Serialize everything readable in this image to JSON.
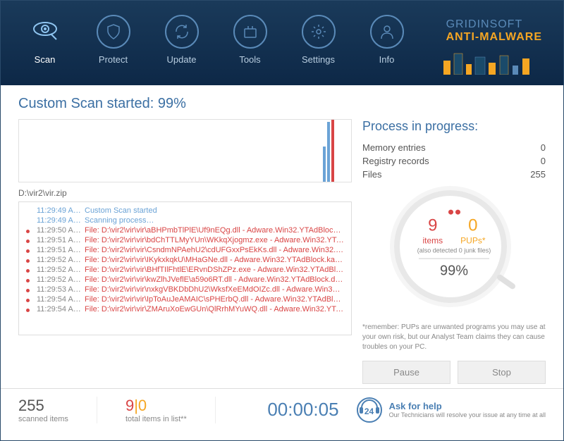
{
  "brand": {
    "line1": "GRIDINSOFT",
    "line2": "ANTI-MALWARE"
  },
  "nav": {
    "scan": "Scan",
    "protect": "Protect",
    "update": "Update",
    "tools": "Tools",
    "settings": "Settings",
    "info": "Info"
  },
  "scan": {
    "title": "Custom Scan started:  99%",
    "filepath": "D:\\vir2\\vir.zip"
  },
  "progress": {
    "title": "Process in progress:",
    "memory_label": "Memory entries",
    "memory_val": "0",
    "registry_label": "Registry records",
    "registry_val": "0",
    "files_label": "Files",
    "files_val": "255"
  },
  "gauge": {
    "items_num": "9",
    "items_label": "items",
    "pups_num": "0",
    "pups_label": "PUPs*",
    "note": "(also detected 0 junk files)",
    "pct": "99%"
  },
  "disclaimer": "*remember: PUPs are unwanted programs you may use at your own risk, but our Analyst Team claims they can cause troubles on your PC.",
  "buttons": {
    "pause": "Pause",
    "stop": "Stop"
  },
  "log": [
    {
      "type": "header",
      "time": "11:29:49 A…",
      "text": "Custom Scan started"
    },
    {
      "type": "header",
      "time": "11:29:49 A…",
      "text": "Scanning process…"
    },
    {
      "type": "threat",
      "time": "11:29:50 A…",
      "text": "File: D:\\vir2\\vir\\vir\\aBHPmbTlPlE\\Uf9nEQg.dll - Adware.Win32.YTAdBlock.…"
    },
    {
      "type": "threat",
      "time": "11:29:51 A…",
      "text": "File: D:\\vir2\\vir\\vir\\bdChTTLMyYUn\\WKkqXjogmz.exe - Adware.Win32.YTA…"
    },
    {
      "type": "threat",
      "time": "11:29:51 A…",
      "text": "File: D:\\vir2\\vir\\vir\\CsndmNPAehU2\\cdUFGxxPsEkKs.dll - Adware.Win32.…"
    },
    {
      "type": "threat",
      "time": "11:29:52 A…",
      "text": "File: D:\\vir2\\vir\\vir\\IKykxkqkU\\MHaGNe.dll - Adware.Win32.YTAdBlock.kals1"
    },
    {
      "type": "threat",
      "time": "11:29:52 A…",
      "text": "File: D:\\vir2\\vir\\vir\\BHfTIlFhtlE\\ERvnDShZPz.exe - Adware.Win32.YTAdBlo…"
    },
    {
      "type": "threat",
      "time": "11:29:52 A…",
      "text": "File: D:\\vir2\\vir\\vir\\kwZlhJVeflE\\a59o6RT.dll - Adware.Win32.YTAdBlock.dd!…"
    },
    {
      "type": "threat",
      "time": "11:29:53 A…",
      "text": "File: D:\\vir2\\vir\\vir\\nxkgVBKDbDhU2\\WksfXeEMdOIZc.dll - Adware.Win32.…"
    },
    {
      "type": "threat",
      "time": "11:29:54 A…",
      "text": "File: D:\\vir2\\vir\\vir\\IpToAuJeAMAIC\\sPHErbQ.dll - Adware.Win32.YTAdBlo…"
    },
    {
      "type": "threat",
      "time": "11:29:54 A…",
      "text": "File: D:\\vir2\\vir\\vir\\ZMAruXoEwGUn\\QlRrhMYuWQ.dll - Adware.Win32.YTA…"
    }
  ],
  "footer": {
    "scanned_num": "255",
    "scanned_label": "scanned items",
    "total_red": "9",
    "total_orange": "0",
    "total_label": "total items in list**",
    "timer": "00:00:05",
    "help_badge": "24",
    "help_title": "Ask for help",
    "help_sub": "Our Technicians will resolve your issue at any time at all"
  }
}
